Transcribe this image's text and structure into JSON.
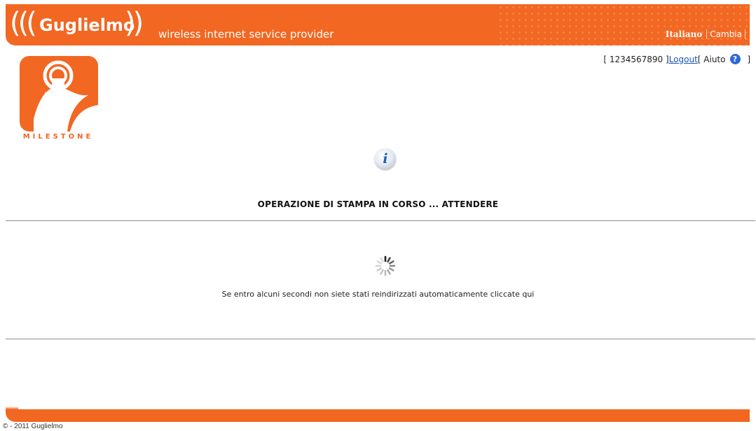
{
  "header": {
    "brand_left_parens": "(((",
    "brand_name": "Guglielmo",
    "brand_right_parens": "))",
    "tagline": "wireless internet service provider",
    "language_current": "Italiano",
    "language_change": "Cambia"
  },
  "userbar": {
    "open_bracket": "[ ",
    "account_id": "1234567890",
    "close_bracket": " ]",
    "logout": "Logout",
    "help_open": "[ ",
    "help": "Aiuto",
    "help_close": " ]"
  },
  "logo": {
    "word": "MILESTONE"
  },
  "status": {
    "title": "OPERAZIONE DI STAMPA IN CORSO ... ATTENDERE",
    "redirect_message": "Se entro alcuni secondi non siete stati reindirizzati automaticamente cliccate qui"
  },
  "footer": {
    "copyright": "© - 2011 Guglielmo"
  },
  "colors": {
    "brand_orange": "#f26722",
    "link_blue": "#1a55b5"
  },
  "icons": [
    "info-icon",
    "help-icon",
    "loading-spinner-icon"
  ]
}
